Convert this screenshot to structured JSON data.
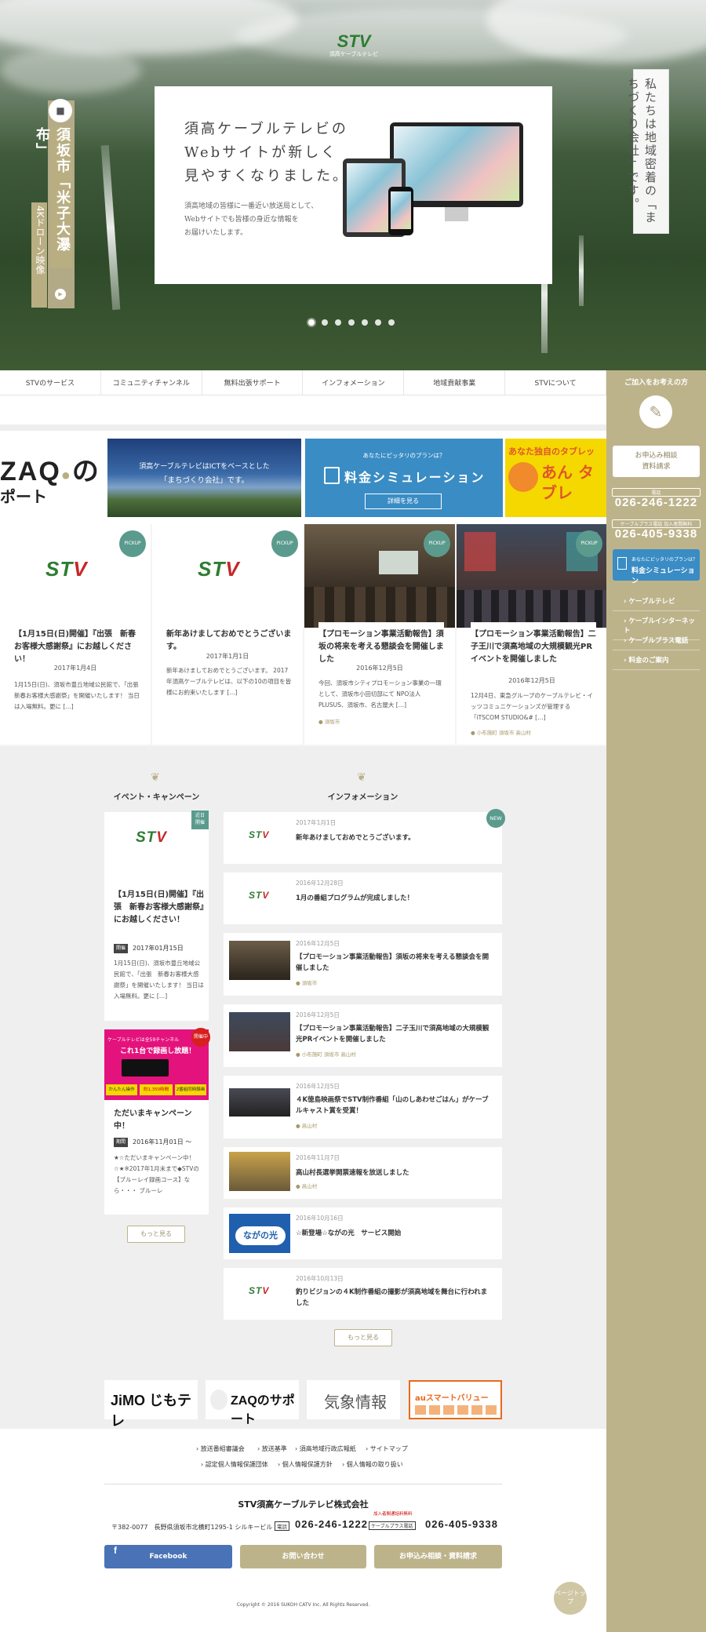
{
  "hero": {
    "logo": "STV",
    "logo_sub": "須高ケーブルテレビ",
    "heading": "須高ケーブルテレビの\nWebサイトが新しく\n見やすくなりました。",
    "body": "須高地域の皆様に一番近い放送局として、\nWebサイトでも皆様の身近な情報を\nお届けいたします。",
    "left_tab_main": "須坂市「米子大瀑布」",
    "left_tab_sub": "4Kドローン映像",
    "right_vertical": "私たちは地域密着の「まちづくり会社」です。",
    "dots": 7,
    "active_dot": 0
  },
  "nav": [
    "STVのサービス",
    "コミュニティチャンネル",
    "無料出張サポート",
    "インフォメーション",
    "地域貢献事業",
    "STVについて"
  ],
  "sidebar": {
    "title": "ご加入をお考えの方",
    "apply_line1": "お申込み相談",
    "apply_line2": "資料請求",
    "tel_label": "電話",
    "tel": "026-246-1222",
    "cable_plus_label": "ケーブルプラス電話 加入者間無料",
    "cable_plus_tel": "026-405-9338",
    "sim_small": "あなたにピッタリのプランは？",
    "sim_label": "料金シミュレーション",
    "links": [
      "ケーブルテレビ",
      "ケーブルインターネット",
      "ケーブルプラス電話",
      "料金のご案内"
    ],
    "pagetop": "ページトップ"
  },
  "banners": {
    "zaq": "ZAQのサポート",
    "machi_line1": "須高ケーブルテレビはICTをベースとした",
    "machi_line2": "「まちづくり会社」です。",
    "sim_small": "あなたにピッタリのプランは？",
    "sim_title": "料金シミュレーション",
    "sim_btn": "詳細を見る",
    "tablet_small": "あなた独自のタブレッ",
    "tablet_big": "あん タブレ"
  },
  "pickup": [
    {
      "badge": "PICKUP",
      "title": "【1月15日(日)開催】『出張　新春お客様大感謝祭』にお越しください！",
      "date": "2017年1月4日",
      "body": "1月15日(日)、須坂市豊丘地域公民館で、「出張　新春お客様大感謝祭」を開催いたします！ 当日は入場無料。更に […]",
      "tag": ""
    },
    {
      "badge": "PICKUP",
      "title": "新年あけましておめでとうございます。",
      "date": "2017年1月1日",
      "body": "新年あけましておめでとうございます。 2017年須高ケーブルテレビは、以下の10の項目を皆様にお約束いたします […]",
      "tag": ""
    },
    {
      "badge": "PICKUP",
      "title": "【プロモーション事業活動報告】須坂の将来を考える懇談会を開催しました",
      "date": "2016年12月5日",
      "body": "今回、須坂市シティプロモーション事業の一環として、須坂市小田切部にて NPO法人PLUSUS、須坂市、名古屋大 […]",
      "tag": "須坂市"
    },
    {
      "badge": "PICKUP",
      "title": "【プロモーション事業活動報告】二子王川で須高地域の大規模観光PRイベントを開催しました",
      "date": "2016年12月5日",
      "body": "12月4日、東急グループのケーブルテレビ・イッツコミュニケーションズが管理する「iTSCOM STUDIO&# […]",
      "tag": "小布施町 須坂市 高山村"
    }
  ],
  "events": {
    "heading": "イベント・キャンペーン",
    "items": [
      {
        "badge": "近日開催",
        "title": "【1月15日(日)開催】『出張　新春お客様大感謝祭』にお越しください！",
        "label": "開催",
        "date": "2017年01月15日",
        "body": "1月15日(日)、須坂市豊丘地域公民館で、「出張　新春お客様大感謝祭」を開催いたします！ 当日は入場無料。更に […]"
      },
      {
        "badge": "開催中",
        "title": "ただいまキャンペーン中！",
        "label": "期間",
        "date": "2016年11月01日 ～",
        "body": "★☆ただいまキャンペーン中！☆★※2017年1月末まで◆STVの【ブルーレイ録画コース】なら・・・ ブルーレ",
        "promo_line1": "ケーブルテレビは全59チャンネル",
        "promo_line2": "これ1台で録画し放題！",
        "promo_a": "かんたん操作",
        "promo_b": "約1,350時間",
        "promo_c": "2番組同時録画"
      }
    ],
    "more": "もっと見る"
  },
  "information": {
    "heading": "インフォメーション",
    "items": [
      {
        "date": "2017年1月1日",
        "title": "新年あけましておめでとうございます。",
        "tag": "",
        "badge": "NEW"
      },
      {
        "date": "2016年12月28日",
        "title": "1月の番組プログラムが完成しました！",
        "tag": "",
        "badge": ""
      },
      {
        "date": "2016年12月5日",
        "title": "【プロモーション事業活動報告】須坂の将来を考える懇談会を開催しました",
        "tag": "須坂市",
        "badge": ""
      },
      {
        "date": "2016年12月5日",
        "title": "【プロモーション事業活動報告】二子玉川で須高地域の大規模観光PRイベントを開催しました",
        "tag": "小布施町 須坂市 高山村",
        "badge": ""
      },
      {
        "date": "2016年12月5日",
        "title": "４K徳島映画祭でSTV制作番組「山のしあわせごはん」がケーブルキャスト賞を受賞！",
        "tag": "高山村",
        "badge": ""
      },
      {
        "date": "2016年11月7日",
        "title": "高山村長選挙開票速報を放送しました",
        "tag": "高山村",
        "badge": ""
      },
      {
        "date": "2016年10月16日",
        "title": "☆新登場☆ながの光　サービス開始",
        "tag": "",
        "badge": ""
      },
      {
        "date": "2016年10月13日",
        "title": "釣りビジョンの４K制作番組の撮影が須高地域を舞台に行われました",
        "tag": "",
        "badge": ""
      }
    ],
    "nagano": "ながの光",
    "more": "もっと見る"
  },
  "logos": [
    "JiMO じもテレ",
    "ZAQのサポート",
    "気象情報",
    "auスマートバリュー"
  ],
  "footer": {
    "links_row1": [
      "放送番組審議会",
      "放送基準",
      "須高地域行政広報紙",
      "サイトマップ"
    ],
    "links_row2": [
      "認定個人情報保護団体",
      "個人情報保護方針",
      "個人情報の取り扱い"
    ],
    "company": "STV須高ケーブルテレビ株式会社",
    "address": "〒382-0077　長野県須坂市北横町1295-1 シルキービル",
    "tel_label": "電話",
    "tel": "026-246-1222",
    "cp_note": "加入者間通話料無料",
    "cp_label": "ケーブルプラス電話",
    "cp_tel": "026-405-9338",
    "btn_facebook": "Facebook",
    "btn_contact": "お問い合わせ",
    "btn_apply": "お申込み相談・資料請求",
    "copyright": "Copyright © 2016 SUKOH CATV Inc. All Rights Reserved."
  },
  "colors": {
    "accent": "#bdb38b",
    "stv_green": "#2e7d32",
    "stv_red": "#c62828",
    "sim_blue": "#3a8cc4",
    "pickup_teal": "#5b9b8e"
  }
}
